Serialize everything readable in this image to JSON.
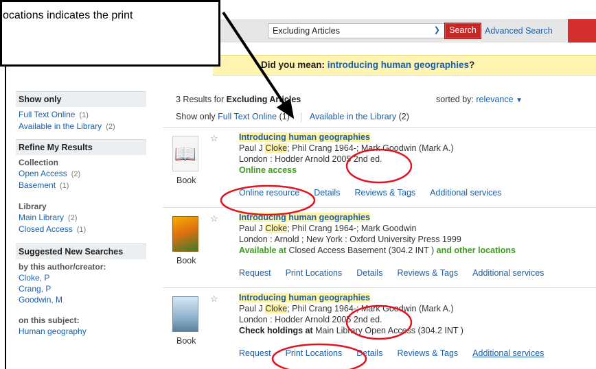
{
  "callout": {
    "text": "ocations indicates the print"
  },
  "search": {
    "scope_value": "Excluding Articles",
    "button_label": "Search",
    "advanced_label": "Advanced Search"
  },
  "did_you_mean": {
    "prefix": "Did you mean: ",
    "suggestion": "introducing human geographies",
    "suffix": "?"
  },
  "sidebar": {
    "show_only_heading": "Show only",
    "show_only_items": [
      {
        "label": "Full Text Online",
        "count": "(1)"
      },
      {
        "label": "Available in the Library",
        "count": "(2)"
      }
    ],
    "refine_heading": "Refine My Results",
    "collection_label": "Collection",
    "collection_items": [
      {
        "label": "Open Access",
        "count": "(2)"
      },
      {
        "label": "Basement",
        "count": "(1)"
      }
    ],
    "library_label": "Library",
    "library_items": [
      {
        "label": "Main Library",
        "count": "(2)"
      },
      {
        "label": "Closed Access",
        "count": "(1)"
      }
    ],
    "suggested_heading": "Suggested New Searches",
    "author_label": "by this author/creator:",
    "author_items": [
      "Cloke, P",
      "Crang, P",
      "Goodwin, M"
    ],
    "subject_label": "on this subject:",
    "subject_items": [
      "Human geography"
    ]
  },
  "results": {
    "count_prefix": "3 Results for ",
    "query": "Excluding Articles",
    "sorted_label": "sorted by:",
    "sort_value": "relevance",
    "filter_label": "Show only",
    "filter_fulltext": "Full Text Online",
    "filter_fulltext_count": "(1)",
    "filter_library": "Available in the Library",
    "filter_library_count": "(2)",
    "records": [
      {
        "title": "Introducing human geographies",
        "authors_pre": "Paul J ",
        "authors_hl": "Cloke",
        "authors_post": "; Phil Crang 1964-; Mark Goodwin (Mark A.)",
        "publisher": "London : Hodder Arnold 2005 2nd ed.",
        "status": "Online access",
        "format": "Book",
        "actions": [
          "Online resource",
          "Details",
          "Reviews & Tags",
          "Additional services"
        ]
      },
      {
        "title": "Introducing human geographies",
        "authors_pre": "Paul J ",
        "authors_hl": "Cloke",
        "authors_post": "; Phil Crang 1964-; Mark Goodwin",
        "publisher": "London : Arnold ; New York : Oxford University Press 1999",
        "status_lead": "Available at ",
        "status_loc": "Closed Access Basement (304.2 INT )",
        "status_tail": " and other locations",
        "format": "Book",
        "actions": [
          "Request",
          "Print Locations",
          "Details",
          "Reviews & Tags",
          "Additional services"
        ]
      },
      {
        "title": "Introducing human geographies",
        "authors_pre": "Paul J ",
        "authors_hl": "Cloke",
        "authors_post": "; Phil Crang 1964-; Mark Goodwin (Mark A.)",
        "publisher": "London : Hodder Arnold 2005 2nd ed.",
        "status_lead": "Check holdings at ",
        "status_loc": "Main Library Open Access (304.2 INT )",
        "format": "Book",
        "actions": [
          "Request",
          "Print Locations",
          "Details",
          "Reviews & Tags",
          "Additional services"
        ]
      }
    ]
  },
  "colors": {
    "link": "#1a5fa8",
    "search_button": "#c62828",
    "highlight": "#fff3a8",
    "status_green": "#3e9b1f",
    "annotation_red": "#e0141e"
  }
}
